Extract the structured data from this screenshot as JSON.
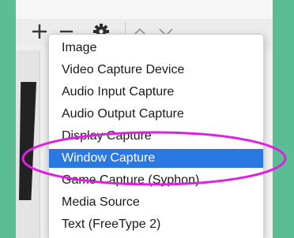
{
  "toolbar": {
    "icons": [
      "plus-icon",
      "minus-icon",
      "gear-icon",
      "chevron-up-icon",
      "chevron-down-icon"
    ]
  },
  "menu": {
    "items": [
      {
        "label": "Image"
      },
      {
        "label": "Video Capture Device"
      },
      {
        "label": "Audio Input Capture"
      },
      {
        "label": "Audio Output Capture"
      },
      {
        "label": "Display Capture"
      },
      {
        "label": "Window Capture",
        "selected": true
      },
      {
        "label": "Game Capture (Syphon)"
      },
      {
        "label": "Media Source"
      },
      {
        "label": "Text (FreeType 2)"
      }
    ]
  },
  "colors": {
    "background": "#5bbd94",
    "selection": "#2a78e2",
    "highlight_ellipse": "#e020e0"
  }
}
